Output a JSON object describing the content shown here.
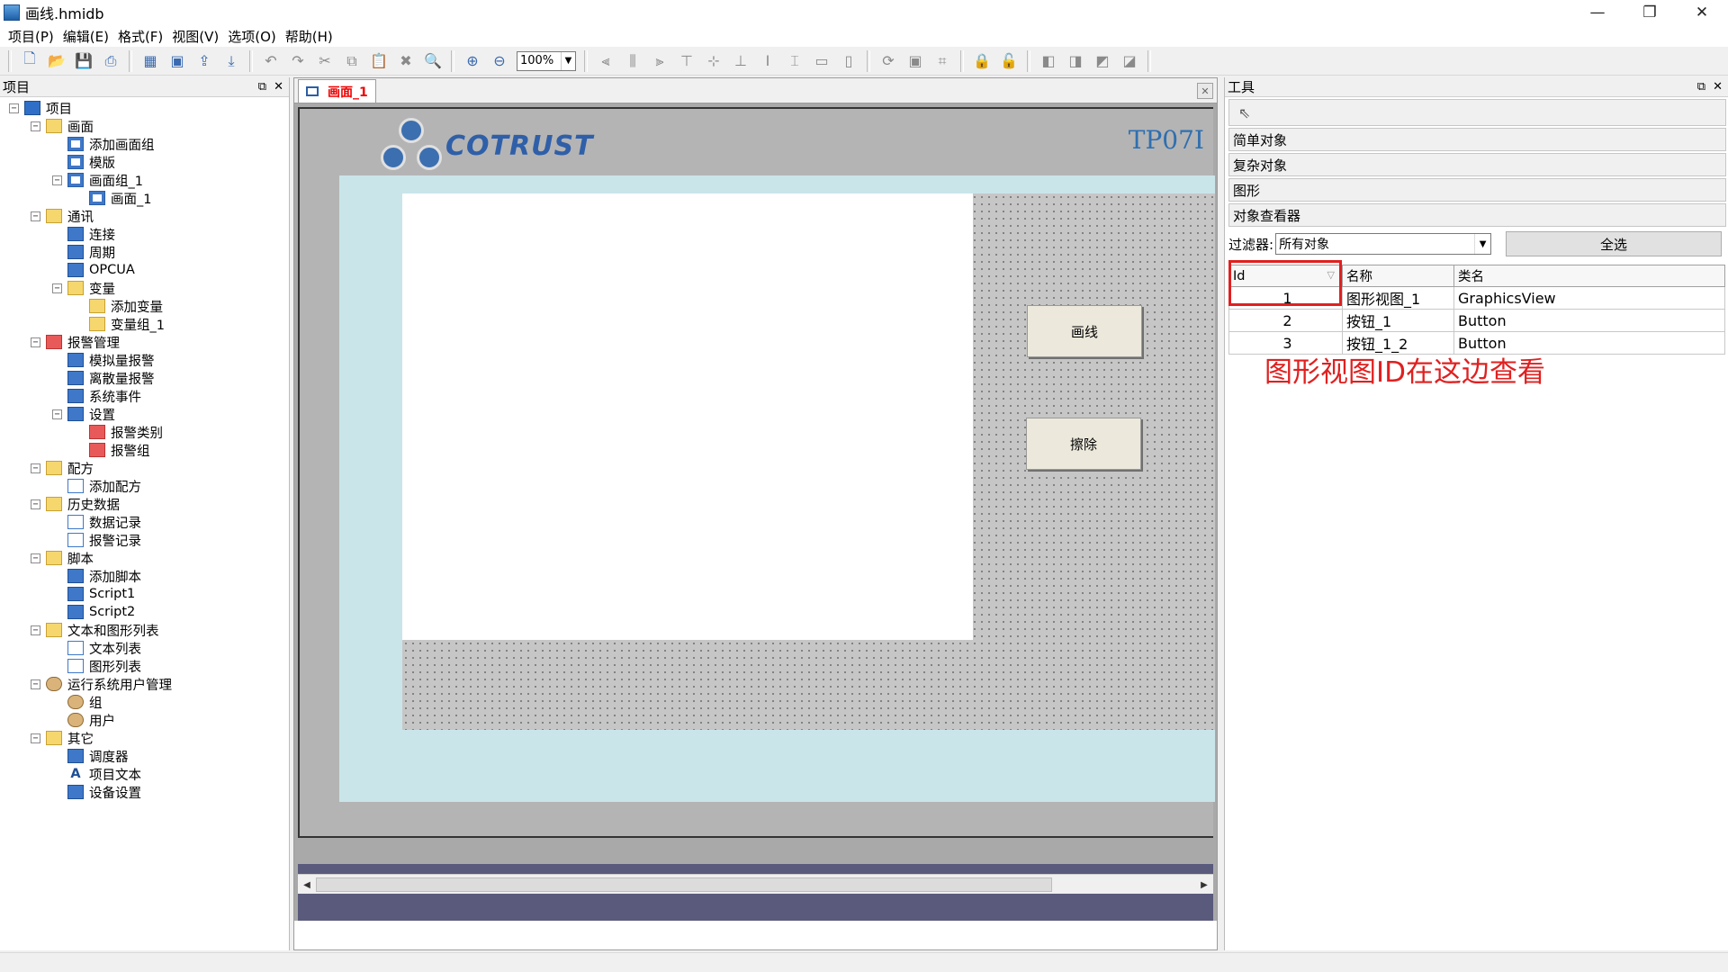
{
  "window": {
    "title": "画线.hmidb",
    "minimize": "—",
    "maximize": "❐",
    "close": "✕"
  },
  "menu": [
    "项目(P)",
    "编辑(E)",
    "格式(F)",
    "视图(V)",
    "选项(O)",
    "帮助(H)"
  ],
  "toolbar": {
    "zoom": "100%"
  },
  "project_panel": {
    "title": "项目",
    "tree": [
      {
        "label": "项目",
        "level": 0,
        "toggle": "−",
        "icon": "root"
      },
      {
        "label": "画面",
        "level": 1,
        "toggle": "−",
        "icon": "folder"
      },
      {
        "label": "添加画面组",
        "level": 2,
        "toggle": "",
        "icon": "screen"
      },
      {
        "label": "模版",
        "level": 2,
        "toggle": "",
        "icon": "screen"
      },
      {
        "label": "画面组_1",
        "level": 2,
        "toggle": "−",
        "icon": "screen"
      },
      {
        "label": "画面_1",
        "level": 3,
        "toggle": "",
        "icon": "screen"
      },
      {
        "label": "通讯",
        "level": 1,
        "toggle": "−",
        "icon": "folder"
      },
      {
        "label": "连接",
        "level": 2,
        "toggle": "",
        "icon": "blue"
      },
      {
        "label": "周期",
        "level": 2,
        "toggle": "",
        "icon": "blue"
      },
      {
        "label": "OPCUA",
        "level": 2,
        "toggle": "",
        "icon": "blue"
      },
      {
        "label": "变量",
        "level": 2,
        "toggle": "−",
        "icon": "folder"
      },
      {
        "label": "添加变量",
        "level": 3,
        "toggle": "",
        "icon": "folder"
      },
      {
        "label": "变量组_1",
        "level": 3,
        "toggle": "",
        "icon": "folder"
      },
      {
        "label": "报警管理",
        "level": 1,
        "toggle": "−",
        "icon": "red"
      },
      {
        "label": "模拟量报警",
        "level": 2,
        "toggle": "",
        "icon": "blue"
      },
      {
        "label": "离散量报警",
        "level": 2,
        "toggle": "",
        "icon": "blue"
      },
      {
        "label": "系统事件",
        "level": 2,
        "toggle": "",
        "icon": "blue"
      },
      {
        "label": "设置",
        "level": 2,
        "toggle": "−",
        "icon": "blue"
      },
      {
        "label": "报警类别",
        "level": 3,
        "toggle": "",
        "icon": "red"
      },
      {
        "label": "报警组",
        "level": 3,
        "toggle": "",
        "icon": "red"
      },
      {
        "label": "配方",
        "level": 1,
        "toggle": "−",
        "icon": "folder"
      },
      {
        "label": "添加配方",
        "level": 2,
        "toggle": "",
        "icon": "doc"
      },
      {
        "label": "历史数据",
        "level": 1,
        "toggle": "−",
        "icon": "folder"
      },
      {
        "label": "数据记录",
        "level": 2,
        "toggle": "",
        "icon": "doc"
      },
      {
        "label": "报警记录",
        "level": 2,
        "toggle": "",
        "icon": "doc"
      },
      {
        "label": "脚本",
        "level": 1,
        "toggle": "−",
        "icon": "folder"
      },
      {
        "label": "添加脚本",
        "level": 2,
        "toggle": "",
        "icon": "blue"
      },
      {
        "label": "Script1",
        "level": 2,
        "toggle": "",
        "icon": "blue"
      },
      {
        "label": "Script2",
        "level": 2,
        "toggle": "",
        "icon": "blue"
      },
      {
        "label": "文本和图形列表",
        "level": 1,
        "toggle": "−",
        "icon": "folder"
      },
      {
        "label": "文本列表",
        "level": 2,
        "toggle": "",
        "icon": "doc"
      },
      {
        "label": "图形列表",
        "level": 2,
        "toggle": "",
        "icon": "doc"
      },
      {
        "label": "运行系统用户管理",
        "level": 1,
        "toggle": "−",
        "icon": "person"
      },
      {
        "label": "组",
        "level": 2,
        "toggle": "",
        "icon": "person"
      },
      {
        "label": "用户",
        "level": 2,
        "toggle": "",
        "icon": "person"
      },
      {
        "label": "其它",
        "level": 1,
        "toggle": "−",
        "icon": "folder"
      },
      {
        "label": "调度器",
        "level": 2,
        "toggle": "",
        "icon": "blue"
      },
      {
        "label": "项目文本",
        "level": 2,
        "toggle": "",
        "icon": "text"
      },
      {
        "label": "设备设置",
        "level": 2,
        "toggle": "",
        "icon": "blue"
      }
    ]
  },
  "editor": {
    "tab_label": "画面_1",
    "logo_text": "COTRUST",
    "model_label": "TP07I",
    "buttons": {
      "draw": "画线",
      "erase": "擦除"
    }
  },
  "tools_panel": {
    "title": "工具",
    "sections": [
      "简单对象",
      "复杂对象",
      "图形",
      "对象查看器"
    ],
    "filter_label": "过滤器:",
    "filter_value": "所有对象",
    "select_all": "全选",
    "table": {
      "headers": [
        "Id",
        "名称",
        "类名"
      ],
      "rows": [
        [
          "1",
          "图形视图_1",
          "GraphicsView"
        ],
        [
          "2",
          "按钮_1",
          "Button"
        ],
        [
          "3",
          "按钮_1_2",
          "Button"
        ]
      ]
    },
    "annotation": "图形视图ID在这边查看"
  },
  "colors": {
    "accent_red": "#e02020",
    "canvas_cyan": "#c9e5ea",
    "device_bottom": "#5a5a7c"
  }
}
